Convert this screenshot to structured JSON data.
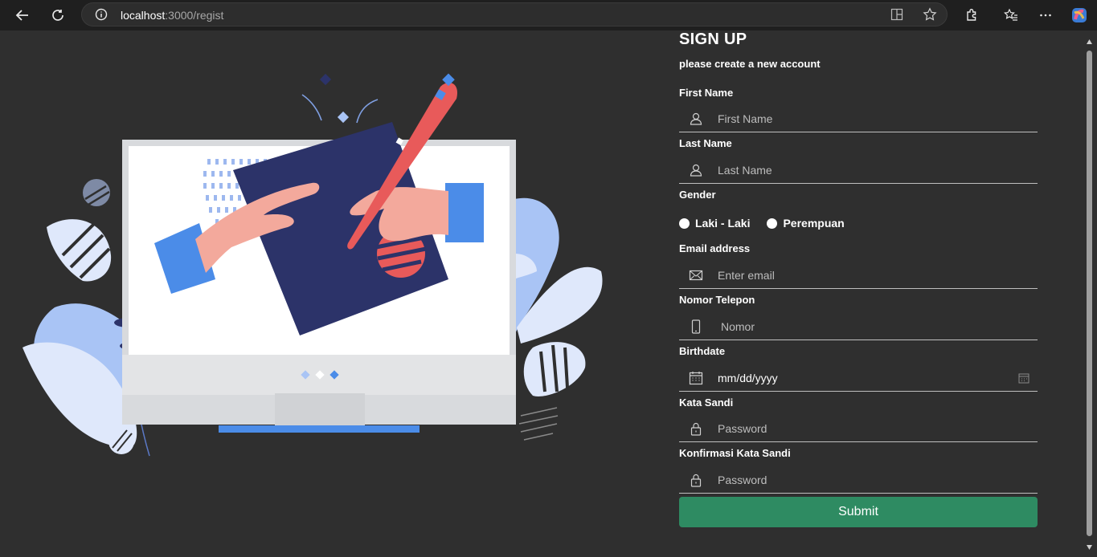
{
  "browser": {
    "url_host": "localhost",
    "url_path": ":3000/regist"
  },
  "form": {
    "title": "SIGN UP",
    "subtitle": "please create a new account",
    "first_name": {
      "label": "First Name",
      "placeholder": "First Name"
    },
    "last_name": {
      "label": "Last Name",
      "placeholder": "Last Name"
    },
    "gender": {
      "label": "Gender",
      "options": [
        "Laki - Laki",
        "Perempuan"
      ]
    },
    "email": {
      "label": "Email address",
      "placeholder": "Enter email"
    },
    "phone": {
      "label": "Nomor Telepon",
      "placeholder": "Nomor"
    },
    "birthdate": {
      "label": "Birthdate",
      "value": "mm/dd/yyyy"
    },
    "password": {
      "label": "Kata Sandi",
      "placeholder": "Password"
    },
    "confirm_password": {
      "label": "Konfirmasi Kata Sandi",
      "placeholder": "Password"
    },
    "submit_label": "Submit"
  },
  "colors": {
    "submit": "#2e8b62",
    "background": "#2f2f2f"
  },
  "icons": [
    "back-arrow-icon",
    "refresh-icon",
    "info-icon",
    "split-screen-icon",
    "star-icon",
    "extensions-icon",
    "favorites-icon",
    "more-icon",
    "copilot-icon",
    "user-icon",
    "envelope-icon",
    "phone-icon",
    "calendar-icon",
    "lock-icon"
  ]
}
